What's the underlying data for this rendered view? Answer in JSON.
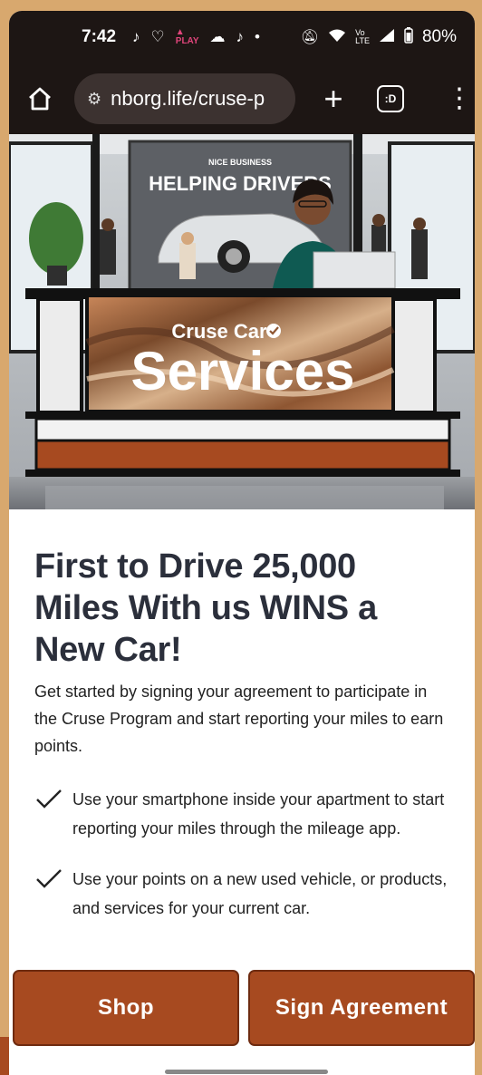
{
  "status_bar": {
    "time": "7:42",
    "battery": "80%",
    "icons_left": [
      "tiktok-icon",
      "heart-icon",
      "play-games-icon",
      "cloud-icon",
      "tiktok-icon",
      "dot-icon"
    ],
    "icons_right": [
      "mute-icon",
      "wifi-icon",
      "volte-icon",
      "signal-icon",
      "battery-icon"
    ]
  },
  "browser": {
    "url": "nborg.life/cruse-p",
    "tabs_label": ":D"
  },
  "hero": {
    "sign_small": "NICE BUSINESS",
    "sign_text": "HELPING DRIVERS",
    "brand_top": "Cruse Car",
    "brand_main": "Services"
  },
  "main": {
    "headline": "First to Drive 25,000 Miles With us WINS a New Car!",
    "intro": "Get started by signing your agreement to participate in the Cruse Program and start reporting your miles to earn points.",
    "checklist": [
      "Use your smartphone inside your apartment to start reporting your miles through the mileage app.",
      "Use your points on a new used vehicle, or products, and services for your current car."
    ]
  },
  "buttons": {
    "shop": "Shop",
    "sign": "Sign Agreement"
  },
  "colors": {
    "accent": "#a74a20",
    "headline": "#2b2f3b",
    "bar": "#1d1614"
  }
}
